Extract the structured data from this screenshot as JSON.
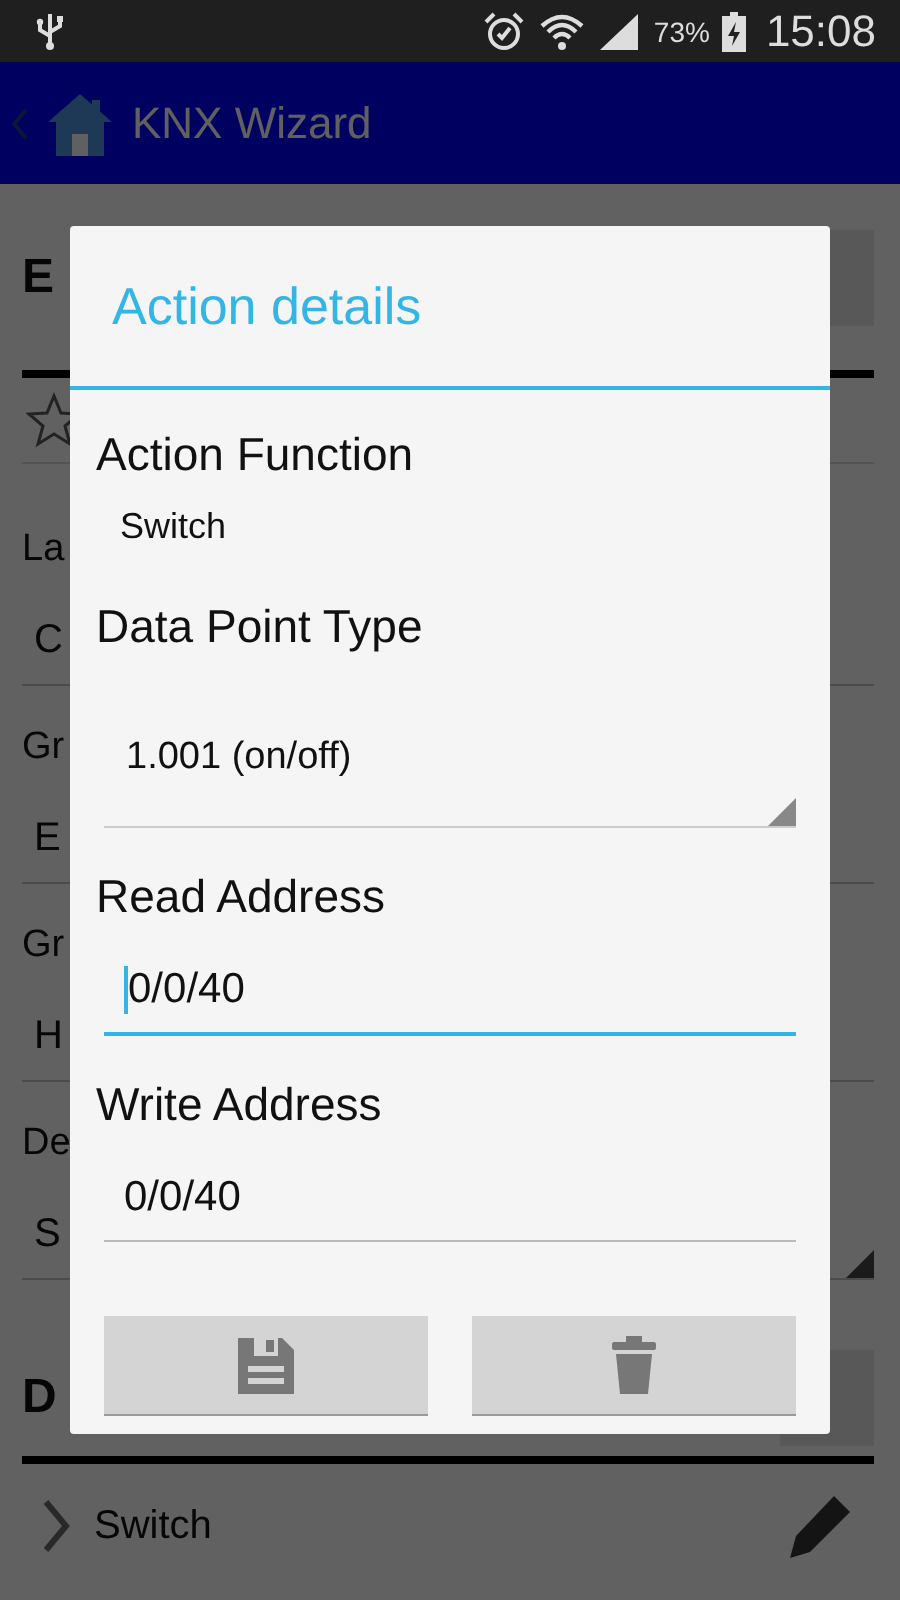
{
  "status_bar": {
    "battery": "73%",
    "time": "15:08"
  },
  "action_bar": {
    "title": "KNX Wizard"
  },
  "background": {
    "header_1": {
      "title": "E"
    },
    "fields": [
      {
        "label": "La",
        "value": "C",
        "kind": "text"
      },
      {
        "label": "Gr",
        "value": "E",
        "kind": "text"
      },
      {
        "label": "Gr",
        "value": "H",
        "kind": "text"
      },
      {
        "label": "De",
        "value": "S",
        "kind": "spinner"
      }
    ],
    "header_2": {
      "title": "D"
    },
    "actions": [
      {
        "label": "Switch"
      }
    ]
  },
  "dialog": {
    "title": "Action details",
    "fields": [
      {
        "label": "Action Function",
        "value": "Switch",
        "kind": "text"
      },
      {
        "label": "Data Point Type",
        "value": "1.001 (on/off)",
        "kind": "spinner"
      },
      {
        "label": "Read Address",
        "value": "0/0/40",
        "kind": "input",
        "focused": true
      },
      {
        "label": "Write Address",
        "value": "0/0/40",
        "kind": "input",
        "focused": false
      }
    ]
  }
}
